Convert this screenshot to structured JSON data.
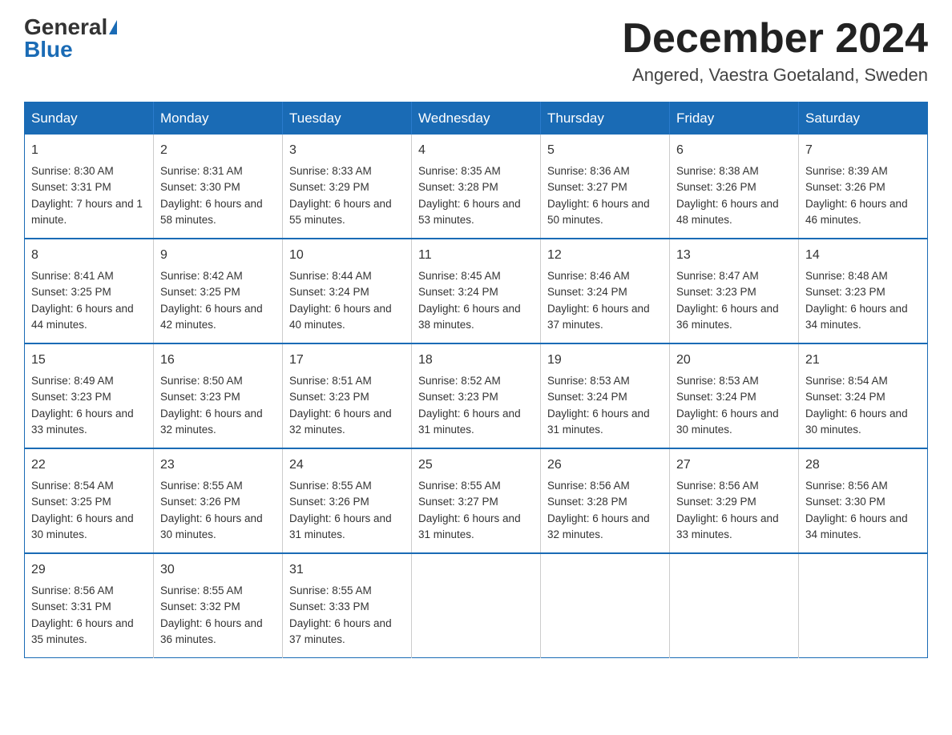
{
  "header": {
    "logo_general": "General",
    "logo_blue": "Blue",
    "month_title": "December 2024",
    "location": "Angered, Vaestra Goetaland, Sweden"
  },
  "weekdays": [
    "Sunday",
    "Monday",
    "Tuesday",
    "Wednesday",
    "Thursday",
    "Friday",
    "Saturday"
  ],
  "weeks": [
    [
      {
        "day": "1",
        "sunrise": "8:30 AM",
        "sunset": "3:31 PM",
        "daylight": "7 hours and 1 minute."
      },
      {
        "day": "2",
        "sunrise": "8:31 AM",
        "sunset": "3:30 PM",
        "daylight": "6 hours and 58 minutes."
      },
      {
        "day": "3",
        "sunrise": "8:33 AM",
        "sunset": "3:29 PM",
        "daylight": "6 hours and 55 minutes."
      },
      {
        "day": "4",
        "sunrise": "8:35 AM",
        "sunset": "3:28 PM",
        "daylight": "6 hours and 53 minutes."
      },
      {
        "day": "5",
        "sunrise": "8:36 AM",
        "sunset": "3:27 PM",
        "daylight": "6 hours and 50 minutes."
      },
      {
        "day": "6",
        "sunrise": "8:38 AM",
        "sunset": "3:26 PM",
        "daylight": "6 hours and 48 minutes."
      },
      {
        "day": "7",
        "sunrise": "8:39 AM",
        "sunset": "3:26 PM",
        "daylight": "6 hours and 46 minutes."
      }
    ],
    [
      {
        "day": "8",
        "sunrise": "8:41 AM",
        "sunset": "3:25 PM",
        "daylight": "6 hours and 44 minutes."
      },
      {
        "day": "9",
        "sunrise": "8:42 AM",
        "sunset": "3:25 PM",
        "daylight": "6 hours and 42 minutes."
      },
      {
        "day": "10",
        "sunrise": "8:44 AM",
        "sunset": "3:24 PM",
        "daylight": "6 hours and 40 minutes."
      },
      {
        "day": "11",
        "sunrise": "8:45 AM",
        "sunset": "3:24 PM",
        "daylight": "6 hours and 38 minutes."
      },
      {
        "day": "12",
        "sunrise": "8:46 AM",
        "sunset": "3:24 PM",
        "daylight": "6 hours and 37 minutes."
      },
      {
        "day": "13",
        "sunrise": "8:47 AM",
        "sunset": "3:23 PM",
        "daylight": "6 hours and 36 minutes."
      },
      {
        "day": "14",
        "sunrise": "8:48 AM",
        "sunset": "3:23 PM",
        "daylight": "6 hours and 34 minutes."
      }
    ],
    [
      {
        "day": "15",
        "sunrise": "8:49 AM",
        "sunset": "3:23 PM",
        "daylight": "6 hours and 33 minutes."
      },
      {
        "day": "16",
        "sunrise": "8:50 AM",
        "sunset": "3:23 PM",
        "daylight": "6 hours and 32 minutes."
      },
      {
        "day": "17",
        "sunrise": "8:51 AM",
        "sunset": "3:23 PM",
        "daylight": "6 hours and 32 minutes."
      },
      {
        "day": "18",
        "sunrise": "8:52 AM",
        "sunset": "3:23 PM",
        "daylight": "6 hours and 31 minutes."
      },
      {
        "day": "19",
        "sunrise": "8:53 AM",
        "sunset": "3:24 PM",
        "daylight": "6 hours and 31 minutes."
      },
      {
        "day": "20",
        "sunrise": "8:53 AM",
        "sunset": "3:24 PM",
        "daylight": "6 hours and 30 minutes."
      },
      {
        "day": "21",
        "sunrise": "8:54 AM",
        "sunset": "3:24 PM",
        "daylight": "6 hours and 30 minutes."
      }
    ],
    [
      {
        "day": "22",
        "sunrise": "8:54 AM",
        "sunset": "3:25 PM",
        "daylight": "6 hours and 30 minutes."
      },
      {
        "day": "23",
        "sunrise": "8:55 AM",
        "sunset": "3:26 PM",
        "daylight": "6 hours and 30 minutes."
      },
      {
        "day": "24",
        "sunrise": "8:55 AM",
        "sunset": "3:26 PM",
        "daylight": "6 hours and 31 minutes."
      },
      {
        "day": "25",
        "sunrise": "8:55 AM",
        "sunset": "3:27 PM",
        "daylight": "6 hours and 31 minutes."
      },
      {
        "day": "26",
        "sunrise": "8:56 AM",
        "sunset": "3:28 PM",
        "daylight": "6 hours and 32 minutes."
      },
      {
        "day": "27",
        "sunrise": "8:56 AM",
        "sunset": "3:29 PM",
        "daylight": "6 hours and 33 minutes."
      },
      {
        "day": "28",
        "sunrise": "8:56 AM",
        "sunset": "3:30 PM",
        "daylight": "6 hours and 34 minutes."
      }
    ],
    [
      {
        "day": "29",
        "sunrise": "8:56 AM",
        "sunset": "3:31 PM",
        "daylight": "6 hours and 35 minutes."
      },
      {
        "day": "30",
        "sunrise": "8:55 AM",
        "sunset": "3:32 PM",
        "daylight": "6 hours and 36 minutes."
      },
      {
        "day": "31",
        "sunrise": "8:55 AM",
        "sunset": "3:33 PM",
        "daylight": "6 hours and 37 minutes."
      },
      null,
      null,
      null,
      null
    ]
  ]
}
